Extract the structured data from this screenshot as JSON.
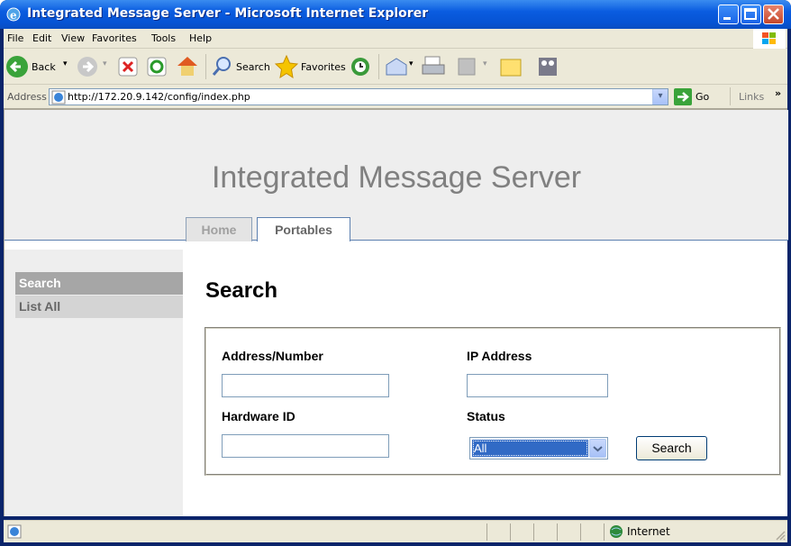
{
  "window": {
    "title": "Integrated Message Server - Microsoft Internet Explorer"
  },
  "menu": [
    "File",
    "Edit",
    "View",
    "Favorites",
    "Tools",
    "Help"
  ],
  "toolbar": {
    "back": "Back",
    "search": "Search",
    "favorites": "Favorites"
  },
  "address": {
    "label": "Address",
    "url": "http://172.20.9.142/config/index.php",
    "go": "Go",
    "links": "Links"
  },
  "site": {
    "title": "Integrated Message Server",
    "tabs": [
      {
        "label": "Home",
        "active": false
      },
      {
        "label": "Portables",
        "active": true
      }
    ]
  },
  "sidebar": {
    "items": [
      {
        "label": "Search",
        "selected": true
      },
      {
        "label": "List All",
        "selected": false
      }
    ]
  },
  "main": {
    "heading": "Search",
    "form": {
      "address_label": "Address/Number",
      "address_value": "",
      "ip_label": "IP Address",
      "ip_value": "",
      "hardware_label": "Hardware ID",
      "hardware_value": "",
      "status_label": "Status",
      "status_value": "All",
      "submit_label": "Search"
    }
  },
  "status_bar": {
    "zone": "Internet"
  },
  "colors": {
    "titlebar": "#0653d3",
    "selected_sidebar": "#a6a6a6",
    "select_highlight": "#316ac5"
  }
}
